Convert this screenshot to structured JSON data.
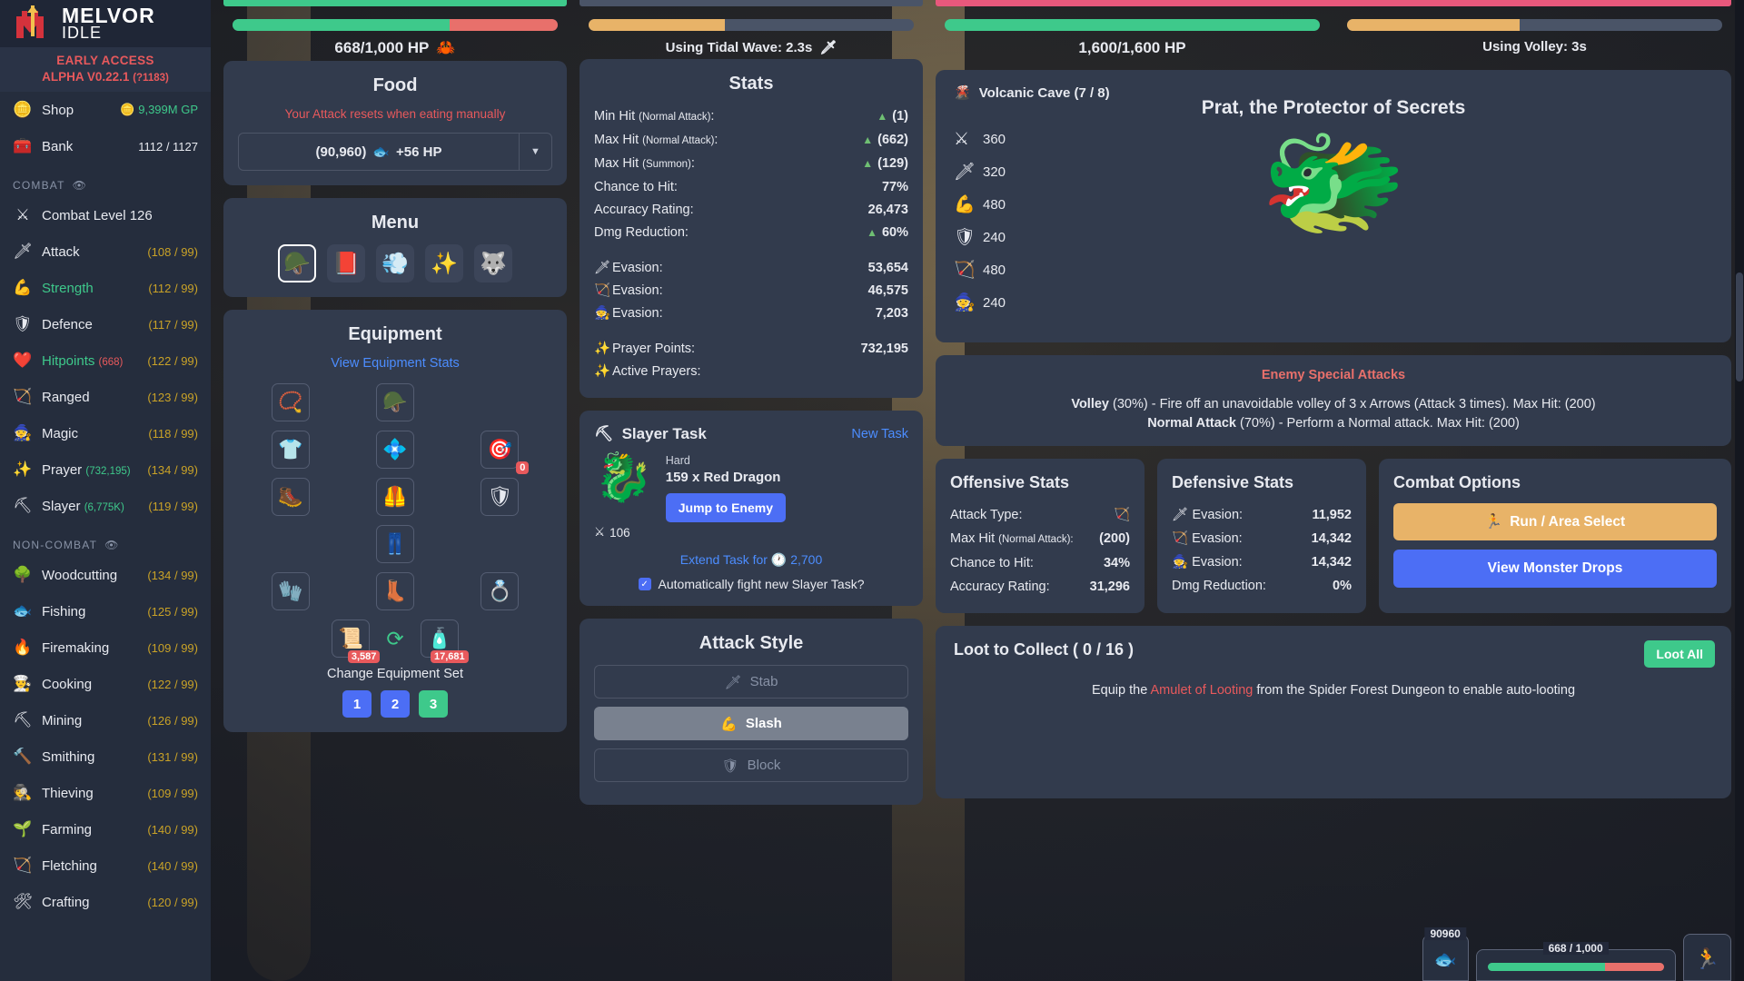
{
  "brand": {
    "line1": "MELVOR",
    "line2": "IDLE",
    "logo_icon": "castle-sword-logo"
  },
  "version": {
    "early_access": "EARLY ACCESS",
    "alpha": "ALPHA V0.22.1",
    "build": "(?1183)"
  },
  "sidebar": {
    "shop": {
      "label": "Shop",
      "icon": "coin-icon",
      "value": "9,399M GP",
      "value_icon": "coin-icon"
    },
    "bank": {
      "label": "Bank",
      "icon": "chest-icon",
      "value": "1112 / 1127"
    },
    "combat_header": {
      "label": "COMBAT",
      "icon": "eye-icon"
    },
    "noncombat_header": {
      "label": "NON-COMBAT",
      "icon": "eye-icon"
    },
    "combat_items": [
      {
        "label": "Combat Level 126",
        "icon": "crossed-swords-icon",
        "right": "",
        "extra": "",
        "green": false
      },
      {
        "label": "Attack",
        "icon": "sword-icon",
        "right": "(108 / 99)",
        "extra": "",
        "green": false
      },
      {
        "label": "Strength",
        "icon": "biceps-icon",
        "right": "(112 / 99)",
        "extra": "",
        "green": true
      },
      {
        "label": "Defence",
        "icon": "shield-icon",
        "right": "(117 / 99)",
        "extra": "",
        "green": false
      },
      {
        "label": "Hitpoints",
        "icon": "heart-icon",
        "right": "(122 / 99)",
        "extra": "(668)",
        "green": true
      },
      {
        "label": "Ranged",
        "icon": "bow-icon",
        "right": "(123 / 99)",
        "extra": "",
        "green": false
      },
      {
        "label": "Magic",
        "icon": "wizard-hat-icon",
        "right": "(118 / 99)",
        "extra": "",
        "green": false
      },
      {
        "label": "Prayer",
        "icon": "sparkle-icon",
        "right": "(134 / 99)",
        "extra": "(732,195)",
        "green": false
      },
      {
        "label": "Slayer",
        "icon": "slayer-icon",
        "right": "(119 / 99)",
        "extra": "(6,775K)",
        "green": false
      }
    ],
    "noncombat_items": [
      {
        "label": "Woodcutting",
        "icon": "tree-icon",
        "right": "(134 / 99)"
      },
      {
        "label": "Fishing",
        "icon": "fish-icon",
        "right": "(125 / 99)"
      },
      {
        "label": "Firemaking",
        "icon": "fire-icon",
        "right": "(109 / 99)"
      },
      {
        "label": "Cooking",
        "icon": "chef-hat-icon",
        "right": "(122 / 99)"
      },
      {
        "label": "Mining",
        "icon": "pickaxe-icon",
        "right": "(126 / 99)"
      },
      {
        "label": "Smithing",
        "icon": "anvil-icon",
        "right": "(131 / 99)"
      },
      {
        "label": "Thieving",
        "icon": "thief-icon",
        "right": "(109 / 99)"
      },
      {
        "label": "Farming",
        "icon": "seedling-icon",
        "right": "(140 / 99)"
      },
      {
        "label": "Fletching",
        "icon": "arrows-icon",
        "right": "(140 / 99)"
      },
      {
        "label": "Crafting",
        "icon": "hammer-chisel-icon",
        "right": "(120 / 99)"
      }
    ]
  },
  "player": {
    "hp_text": "668/1,000 HP",
    "hp_pct": 66.8,
    "hp_icon": "crab-icon",
    "timer_icon": "timer-icon",
    "attack_timer_text": "Using Tidal Wave: 2.3s",
    "attack_timer_icon": "sword-icon",
    "attack_timer_pct": 42
  },
  "food": {
    "title": "Food",
    "warning": "Your Attack resets when eating manually",
    "selected": "(90,960)",
    "heal": "+56 HP",
    "icon": "fish-icon",
    "dropdown_icon": "chevron-down-icon"
  },
  "menu": {
    "title": "Menu",
    "items": [
      {
        "icon": "helmet-icon",
        "name": "combat-menu",
        "selected": true
      },
      {
        "icon": "spellbook-icon",
        "name": "spellbook-menu",
        "selected": false
      },
      {
        "icon": "aurora-icon",
        "name": "aurora-menu",
        "selected": false
      },
      {
        "icon": "prayer-icon",
        "name": "prayer-menu",
        "selected": false
      },
      {
        "icon": "wolf-icon",
        "name": "pet-menu",
        "selected": false
      }
    ]
  },
  "equipment": {
    "title": "Equipment",
    "view_stats_link": "View Equipment Stats",
    "slots": [
      {
        "icon": "necklace-icon",
        "name": "amulet-slot",
        "count": ""
      },
      {
        "icon": "helmet-icon",
        "name": "helmet-slot",
        "count": ""
      },
      {
        "icon": "",
        "name": "empty-slot-1",
        "count": ""
      },
      {
        "icon": "shirt-icon",
        "name": "cape-slot",
        "count": ""
      },
      {
        "icon": "necklace-gem-icon",
        "name": "neck-slot",
        "count": ""
      },
      {
        "icon": "quiver-icon",
        "name": "quiver-slot",
        "count": "0"
      },
      {
        "icon": "boot-icon",
        "name": "weapon-slot",
        "count": ""
      },
      {
        "icon": "platebody-icon",
        "name": "body-slot",
        "count": ""
      },
      {
        "icon": "shield-icon",
        "name": "shield-slot",
        "count": ""
      },
      {
        "icon": "",
        "name": "empty-slot-2",
        "count": ""
      },
      {
        "icon": "platelegs-icon",
        "name": "legs-slot",
        "count": ""
      },
      {
        "icon": "",
        "name": "empty-slot-3",
        "count": ""
      },
      {
        "icon": "gloves-icon",
        "name": "gloves-slot",
        "count": ""
      },
      {
        "icon": "boots-icon",
        "name": "boots-slot",
        "count": ""
      },
      {
        "icon": "ring-icon",
        "name": "ring-slot",
        "count": ""
      }
    ],
    "left_item": {
      "icon": "scroll-icon",
      "count": "3,587"
    },
    "swap_icon": "swap-icon",
    "right_item": {
      "icon": "potion-icon",
      "count": "17,681"
    },
    "change_set_label": "Change Equipment Set",
    "set_buttons": [
      {
        "label": "1",
        "active": false
      },
      {
        "label": "2",
        "active": false
      },
      {
        "label": "3",
        "active": true
      }
    ]
  },
  "stats": {
    "title": "Stats",
    "rows": [
      {
        "label": "Min Hit",
        "sub": "(Normal Attack)",
        "value": "(1)",
        "tri": true,
        "icon": ""
      },
      {
        "label": "Max Hit",
        "sub": "(Normal Attack)",
        "value": "(662)",
        "tri": true,
        "icon": ""
      },
      {
        "label": "Max Hit",
        "sub": "(Summon)",
        "value": "(129)",
        "tri": true,
        "icon": ""
      },
      {
        "label": "Chance to Hit:",
        "sub": "",
        "value": "77%",
        "tri": false,
        "icon": ""
      },
      {
        "label": "Accuracy Rating:",
        "sub": "",
        "value": "26,473",
        "tri": false,
        "icon": ""
      },
      {
        "label": "Dmg Reduction:",
        "sub": "",
        "value": "60%",
        "tri": true,
        "icon": ""
      }
    ],
    "evasion": [
      {
        "label": "Evasion:",
        "value": "53,654",
        "icon": "sword-icon"
      },
      {
        "label": "Evasion:",
        "value": "46,575",
        "icon": "bow-icon"
      },
      {
        "label": "Evasion:",
        "value": "7,203",
        "icon": "wizard-hat-icon"
      }
    ],
    "prayer": [
      {
        "label": "Prayer Points:",
        "value": "732,195",
        "icon": "sparkle-icon"
      },
      {
        "label": "Active Prayers:",
        "value": "",
        "icon": "sparkle-icon"
      }
    ]
  },
  "slayer": {
    "title": "Slayer Task",
    "title_icon": "slayer-icon",
    "new_task": "New Task",
    "difficulty": "Hard",
    "task": "159 x Red Dragon",
    "monster_icon": "dragon-icon",
    "jump_button": "Jump to Enemy",
    "kill_icon": "crossed-swords-icon",
    "kill_count": "106",
    "extend_label": "Extend Task for",
    "extend_cost": "2,700",
    "extend_icon": "slayer-coin-icon",
    "auto_fight_label": "Automatically fight new Slayer Task?",
    "auto_fight_checked": true
  },
  "attack_style": {
    "title": "Attack Style",
    "options": [
      {
        "label": "Stab",
        "icon": "sword-icon",
        "active": false
      },
      {
        "label": "Slash",
        "icon": "biceps-icon",
        "active": true
      },
      {
        "label": "Block",
        "icon": "shield-icon",
        "active": false
      }
    ]
  },
  "enemy": {
    "hp_text": "1,600/1,600 HP",
    "hp_pct": 100,
    "timer_text": "Using Volley: 3s",
    "timer_pct": 46,
    "area_icon": "volcano-icon",
    "area": "Volcanic Cave (7 / 8)",
    "name": "Prat, the Protector of Secrets",
    "sprite_icon": "dragon-green-icon",
    "stats": [
      {
        "icon": "crossed-swords-icon",
        "value": "360"
      },
      {
        "icon": "sword-icon",
        "value": "320"
      },
      {
        "icon": "biceps-icon",
        "value": "480"
      },
      {
        "icon": "shield-icon",
        "value": "240"
      },
      {
        "icon": "bow-icon",
        "value": "480"
      },
      {
        "icon": "wizard-hat-icon",
        "value": "240"
      }
    ]
  },
  "special_attacks": {
    "header": "Enemy Special Attacks",
    "lines": [
      {
        "name": "Volley",
        "text": "(30%) - Fire off an unavoidable volley of 3 x Arrows (Attack 3 times). Max Hit: (200)"
      },
      {
        "name": "Normal Attack",
        "text": "(70%) - Perform a Normal attack. Max Hit: (200)"
      }
    ]
  },
  "offensive_stats": {
    "title": "Offensive Stats",
    "rows": [
      {
        "label": "Attack Type:",
        "sub": "",
        "value": "",
        "icon": "bow-icon"
      },
      {
        "label": "Max Hit",
        "sub": "(Normal Attack):",
        "value": "(200)",
        "icon": ""
      },
      {
        "label": "Chance to Hit:",
        "sub": "",
        "value": "34%",
        "icon": ""
      },
      {
        "label": "Accuracy Rating:",
        "sub": "",
        "value": "31,296",
        "icon": ""
      }
    ]
  },
  "defensive_stats": {
    "title": "Defensive Stats",
    "rows": [
      {
        "label": "Evasion:",
        "value": "11,952",
        "icon": "sword-icon"
      },
      {
        "label": "Evasion:",
        "value": "14,342",
        "icon": "bow-icon"
      },
      {
        "label": "Evasion:",
        "value": "14,342",
        "icon": "wizard-hat-icon"
      },
      {
        "label": "Dmg Reduction:",
        "value": "0%",
        "icon": ""
      }
    ]
  },
  "combat_options": {
    "title": "Combat Options",
    "run_button": "Run / Area Select",
    "run_icon": "running-icon",
    "drops_button": "View Monster Drops"
  },
  "loot": {
    "title": "Loot to Collect ( 0 / 16 )",
    "loot_all": "Loot All",
    "hint_pre": "Equip the ",
    "hint_link": "Amulet of Looting",
    "hint_post": " from the Spider Forest Dungeon to enable auto-looting"
  },
  "bottom_bar": {
    "food_count": "90960",
    "food_icon": "fish-icon",
    "hp_label": "668 / 1,000",
    "hp_pct": 66.8,
    "run_icon": "running-icon"
  },
  "colors": {
    "accent_green": "#3ec98b",
    "accent_red": "#e8595c",
    "accent_blue": "#4c6ef5",
    "accent_gold": "#c9a227",
    "panel": "#323b4d",
    "sidebar": "#252d3d"
  }
}
